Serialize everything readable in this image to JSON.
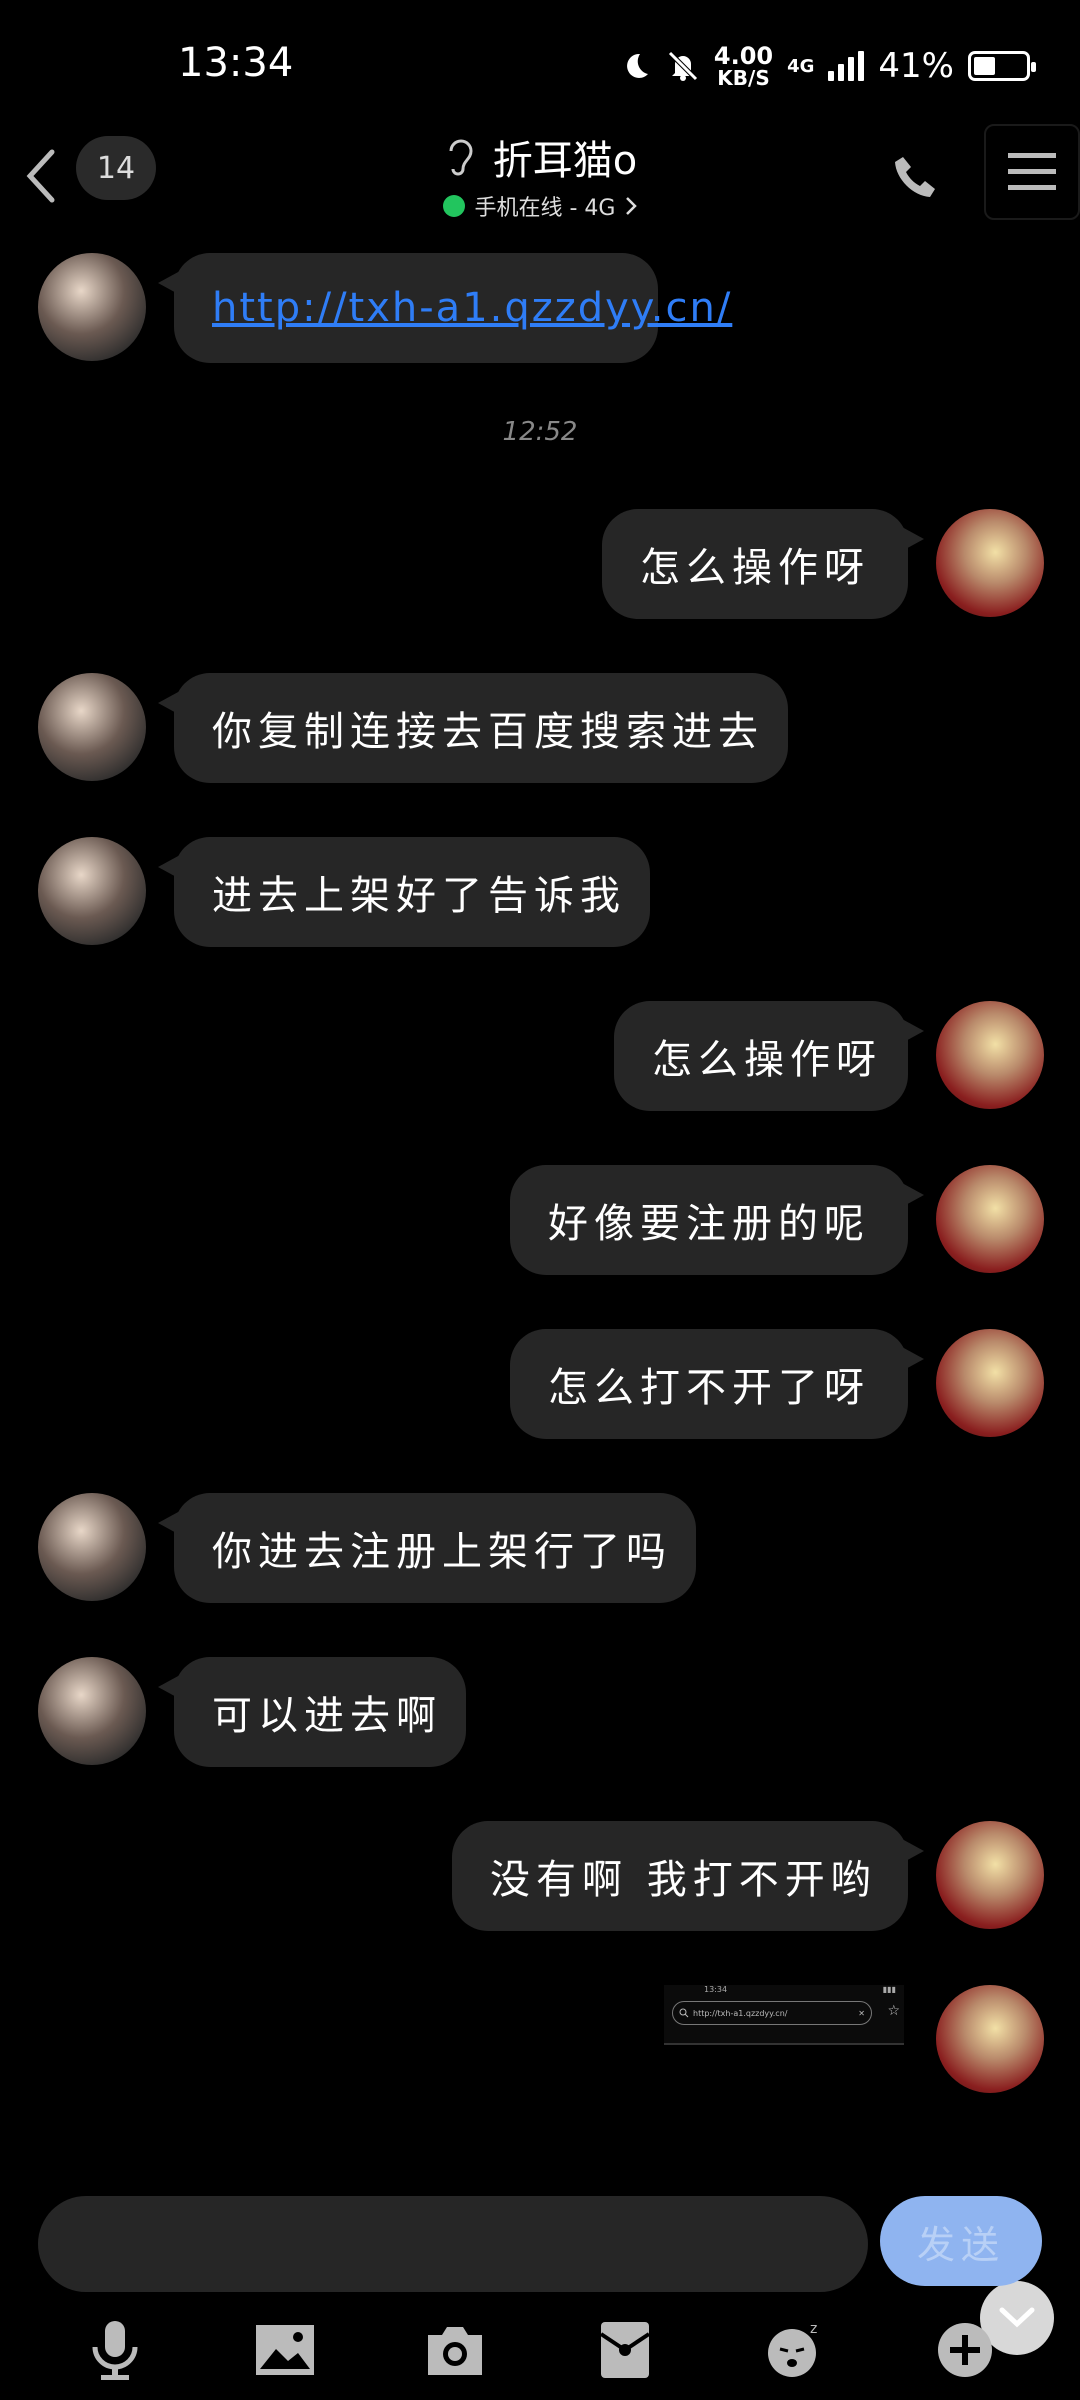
{
  "status_bar": {
    "time": "13:34",
    "speed_value": "4.00",
    "speed_unit": "KB/S",
    "network": "4G",
    "battery": "41%",
    "battery_level": 0.41
  },
  "header": {
    "unread_count": "14",
    "contact_name": "折耳猫o",
    "contact_status": "手机在线 - 4G"
  },
  "chat": {
    "timestamp": "12:52",
    "messages": [
      {
        "side": "left",
        "text": "http://txh-a1.qzzdyy.cn/",
        "is_link": true
      },
      {
        "side": "right",
        "text": "怎么操作呀"
      },
      {
        "side": "left",
        "text": "你复制连接去百度搜索进去"
      },
      {
        "side": "left",
        "text": "进去上架好了告诉我"
      },
      {
        "side": "right",
        "text": "怎么操作呀"
      },
      {
        "side": "right",
        "text": "好像要注册的呢"
      },
      {
        "side": "right",
        "text": "怎么打不开了呀"
      },
      {
        "side": "left",
        "text": "你进去注册上架行了吗"
      },
      {
        "side": "left",
        "text": "可以进去啊"
      },
      {
        "side": "right",
        "text": "没有啊 我打不开哟"
      }
    ],
    "screenshot_thumb": {
      "time": "13:34",
      "url": "http://txh-a1.qzzdyy.cn/"
    }
  },
  "composer": {
    "input_value": "",
    "send_label": "发送"
  },
  "toolbar": {
    "items": [
      "microphone-icon",
      "image-icon",
      "camera-icon",
      "red-packet-icon",
      "sticker-icon",
      "plus-icon"
    ]
  }
}
